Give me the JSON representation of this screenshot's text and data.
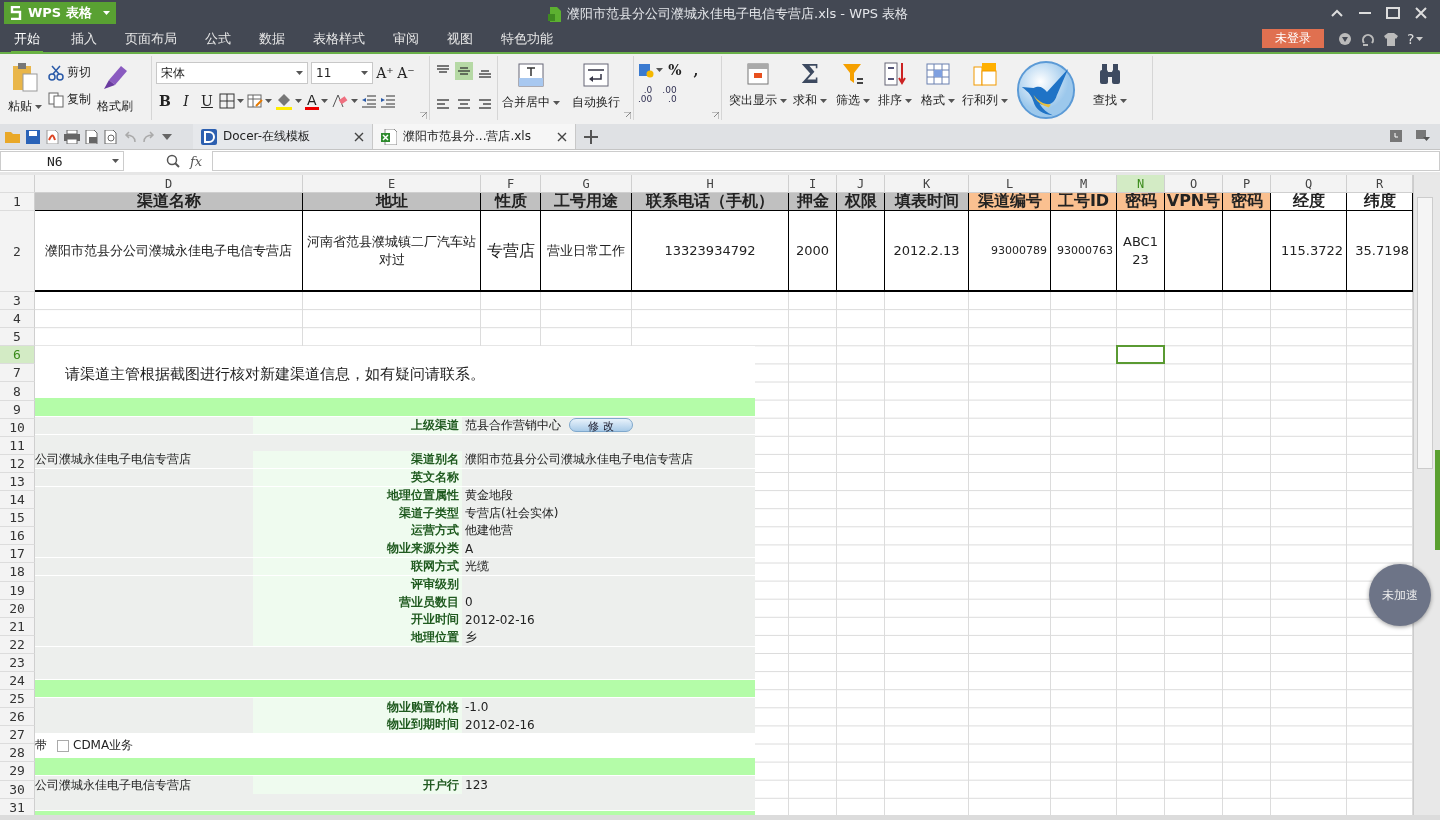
{
  "app_menu": {
    "label": "WPS 表格"
  },
  "window": {
    "title": "濮阳市范县分公司濮城永佳电子电信专营店.xls - WPS 表格"
  },
  "menu_tabs": [
    {
      "label": "开始",
      "selected": true
    },
    {
      "label": "插入",
      "selected": false
    },
    {
      "label": "页面布局",
      "selected": false
    },
    {
      "label": "公式",
      "selected": false
    },
    {
      "label": "数据",
      "selected": false
    },
    {
      "label": "表格样式",
      "selected": false
    },
    {
      "label": "审阅",
      "selected": false
    },
    {
      "label": "视图",
      "selected": false
    },
    {
      "label": "特色功能",
      "selected": false
    }
  ],
  "login_button": {
    "label": "未登录"
  },
  "help_button": {
    "label": "?"
  },
  "ribbon": {
    "paste": {
      "label": "粘贴"
    },
    "cut": {
      "label": "剪切"
    },
    "copy": {
      "label": "复制"
    },
    "format_painter": {
      "label": "格式刷"
    },
    "font": {
      "value": "宋体"
    },
    "font_size": {
      "value": "11"
    },
    "size_buttons": [
      "A⁺",
      "A⁻"
    ],
    "style_buttons": [
      "B",
      "I",
      "U"
    ],
    "font_color": {
      "label": "A"
    },
    "alignment": [
      {
        "selected": false
      },
      {
        "selected": true
      },
      {
        "selected": false
      },
      {
        "selected": false
      },
      {
        "selected": false
      },
      {
        "selected": false
      }
    ],
    "merge": {
      "label": "合并居中"
    },
    "wrap": {
      "label": "自动换行"
    },
    "number_buttons": [
      "%",
      ","
    ],
    "decimal_buttons": [
      {
        "top": ".0",
        "bottom": ".00"
      },
      {
        "top": ".00",
        "bottom": ".0"
      }
    ],
    "tools": [
      {
        "label": "突出显示"
      },
      {
        "glyph": "Σ",
        "label": "求和"
      },
      {
        "label": "筛选"
      },
      {
        "label": "排序"
      },
      {
        "label": "格式"
      },
      {
        "label": "行和列"
      },
      {
        "label": "查找"
      }
    ]
  },
  "doc_tabs": [
    {
      "label": "Docer-在线模板",
      "kind": "docer",
      "selected": false
    },
    {
      "label": "濮阳市范县分...营店.xls",
      "kind": "sheet",
      "selected": true
    }
  ],
  "formula_bar": {
    "name_box": "N6",
    "fx": "fx"
  },
  "sheet": {
    "columns": [
      {
        "letter": "D",
        "selected": false
      },
      {
        "letter": "E",
        "selected": false
      },
      {
        "letter": "F",
        "selected": false
      },
      {
        "letter": "G",
        "selected": false
      },
      {
        "letter": "H",
        "selected": false
      },
      {
        "letter": "I",
        "selected": false
      },
      {
        "letter": "J",
        "selected": false
      },
      {
        "letter": "K",
        "selected": false
      },
      {
        "letter": "L",
        "selected": false
      },
      {
        "letter": "M",
        "selected": false
      },
      {
        "letter": "N",
        "selected": true
      },
      {
        "letter": "O",
        "selected": false
      },
      {
        "letter": "P",
        "selected": false
      },
      {
        "letter": "Q",
        "selected": false
      },
      {
        "letter": "R",
        "selected": false
      }
    ],
    "rows": [
      {
        "number": "1",
        "selected": false
      },
      {
        "number": "2",
        "selected": false
      },
      {
        "number": "3",
        "selected": false
      },
      {
        "number": "4",
        "selected": false
      },
      {
        "number": "5",
        "selected": false
      },
      {
        "number": "6",
        "selected": true
      },
      {
        "number": "7",
        "selected": false
      },
      {
        "number": "8",
        "selected": false
      },
      {
        "number": "9",
        "selected": false
      },
      {
        "number": "10",
        "selected": false
      },
      {
        "number": "11",
        "selected": false
      },
      {
        "number": "12",
        "selected": false
      },
      {
        "number": "13",
        "selected": false
      },
      {
        "number": "14",
        "selected": false
      },
      {
        "number": "15",
        "selected": false
      },
      {
        "number": "16",
        "selected": false
      },
      {
        "number": "17",
        "selected": false
      },
      {
        "number": "18",
        "selected": false
      },
      {
        "number": "19",
        "selected": false
      },
      {
        "number": "20",
        "selected": false
      },
      {
        "number": "21",
        "selected": false
      },
      {
        "number": "22",
        "selected": false
      },
      {
        "number": "23",
        "selected": false
      },
      {
        "number": "24",
        "selected": false
      },
      {
        "number": "25",
        "selected": false
      },
      {
        "number": "26",
        "selected": false
      },
      {
        "number": "27",
        "selected": false
      },
      {
        "number": "28",
        "selected": false
      },
      {
        "number": "29",
        "selected": false
      },
      {
        "number": "30",
        "selected": false
      },
      {
        "number": "31",
        "selected": false
      }
    ],
    "header_cells": [
      {
        "text": "渠道名称",
        "color": "#c0c0c0"
      },
      {
        "text": "地址",
        "color": "#c0c0c0"
      },
      {
        "text": "性质",
        "color": "#c0c0c0"
      },
      {
        "text": "工号用途",
        "color": "#c0c0c0"
      },
      {
        "text": "联系电话（手机）",
        "color": "#c0c0c0"
      },
      {
        "text": "押金",
        "color": "#c0c0c0"
      },
      {
        "text": "权限",
        "color": "#c0c0c0"
      },
      {
        "text": "填表时间",
        "color": "#c0c0c0"
      },
      {
        "text": "渠道编号",
        "color": "#fac090"
      },
      {
        "text": "工号ID",
        "color": "#fac090"
      },
      {
        "text": "密码",
        "color": "#fac090"
      },
      {
        "text": "VPN号",
        "color": "#fac090"
      },
      {
        "text": "密码",
        "color": "#fac090"
      },
      {
        "text": "经度",
        "color": "#ffffff"
      },
      {
        "text": "纬度",
        "color": "#ffffff"
      }
    ],
    "data_cells": [
      {
        "text": "濮阳市范县分公司濮城永佳电子电信专营店"
      },
      {
        "text": "河南省范县濮城镇二厂汽车站对过"
      },
      {
        "text": "专营店"
      },
      {
        "text": "营业日常工作"
      },
      {
        "text": "13323934792"
      },
      {
        "text": "2000"
      },
      {},
      {
        "text": "2012.2.13"
      },
      {
        "text": "93000789"
      },
      {
        "text": "93000763"
      },
      {
        "text": "ABC123"
      },
      {},
      {},
      {
        "text": "115.3722"
      },
      {
        "text": "35.7198"
      }
    ]
  },
  "pasted_image": {
    "note": "请渠道主管根据截图进行核对新建渠道信息，如有疑问请联系。",
    "rows": [
      {
        "kind": "band"
      },
      {
        "kind": "field",
        "label": "上级渠道",
        "value": "范县合作营销中心",
        "button": "修 改"
      },
      {
        "kind": "blank"
      },
      {
        "kind": "field",
        "left": "公司濮城永佳电子电信专营店",
        "label": "渠道别名",
        "value": "濮阳市范县分公司濮城永佳电子电信专营店"
      },
      {
        "kind": "field",
        "label": "英文名称"
      },
      {
        "kind": "field",
        "label": "地理位置属性",
        "value": "黄金地段"
      },
      {
        "kind": "field",
        "label": "渠道子类型",
        "value": "专营店(社会实体)"
      },
      {
        "kind": "field",
        "label": "运营方式",
        "value": "他建他营"
      },
      {
        "kind": "field",
        "label": "物业来源分类",
        "value": "A"
      },
      {
        "kind": "field",
        "label": "联网方式",
        "value": "光缆"
      },
      {
        "kind": "field",
        "label": "评审级别"
      },
      {
        "kind": "field",
        "label": "营业员数目",
        "value": "0"
      },
      {
        "kind": "field",
        "label": "开业时间",
        "value": "2012-02-16"
      },
      {
        "kind": "field",
        "label": "地理位置",
        "value": "乡"
      },
      {
        "kind": "blank"
      },
      {
        "kind": "blank"
      },
      {
        "kind": "band"
      },
      {
        "kind": "field",
        "label": "物业购置价格",
        "value": "-1.0"
      },
      {
        "kind": "field",
        "label": "物业到期时间",
        "value": "2012-02-16"
      },
      {
        "kind": "check",
        "left": "带",
        "label": "CDMA业务",
        "checked": false
      },
      {
        "kind": "band"
      },
      {
        "kind": "field",
        "left": "公司濮城永佳电子电信专营店",
        "label": "开户行",
        "value": "123"
      },
      {
        "kind": "blank"
      },
      {
        "kind": "band"
      }
    ]
  },
  "accelerator_button": {
    "label": "未加速"
  }
}
